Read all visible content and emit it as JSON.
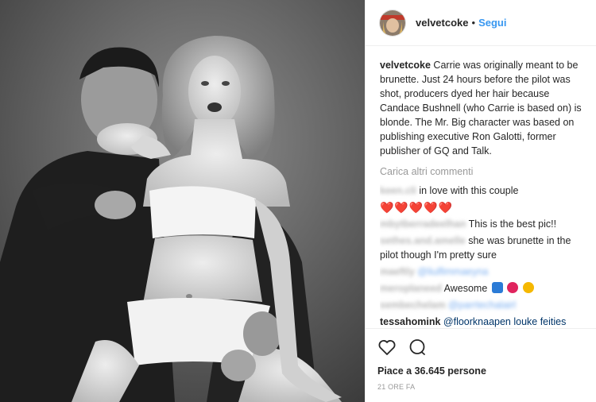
{
  "post": {
    "username": "velvetcoke",
    "separator": "•",
    "follow_label": "Segui",
    "caption": "Carrie was originally meant to be brunette. Just 24 hours before the pilot was shot, producers dyed her hair because Candace Bushnell (who Carrie is based on) is blonde. The Mr. Big character was based on publishing executive Ron Galotti, former publisher of GQ and Talk.",
    "load_more_label": "Carica altri commenti",
    "likes_text": "Piace a 36.645 persone",
    "time_text": "21 ORE FA"
  },
  "comments": [
    {
      "user": "keen.cli",
      "text": "in love with this couple"
    },
    {
      "user": "",
      "text": "❤️❤️❤️❤️❤️"
    },
    {
      "user": "mbytberradeelhan",
      "text": "This is the best pic!!"
    },
    {
      "user": "sethes.and.amelle",
      "text": "she was brunette in the pilot though I'm pretty sure"
    },
    {
      "user": "maeftly",
      "text": "@liulfimmaeyna"
    },
    {
      "user": "meroplaneed",
      "text": "Awesome"
    },
    {
      "user": "sembechelam",
      "text": "@parrtechalairl"
    },
    {
      "user": "tessahomink",
      "text": "@floorknaapen louke feities"
    }
  ],
  "icons": {
    "like": "heart-outline-icon",
    "comment": "speech-bubble-icon"
  },
  "colors": {
    "accent": "#3897f0",
    "heart": "#e0245e",
    "muted": "#999999"
  }
}
